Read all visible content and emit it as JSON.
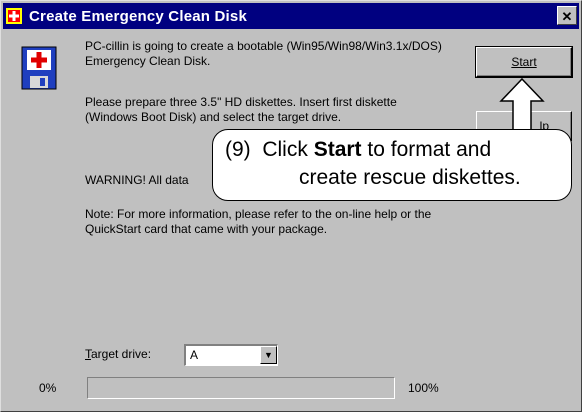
{
  "window": {
    "title": "Create Emergency Clean Disk",
    "close_glyph": "✕"
  },
  "icons": {
    "title": "pc-cillin-app-icon",
    "main": "first-aid-floppy-disk-icon"
  },
  "body": {
    "p1": "PC-cillin is going to create a bootable (Win95/Win98/Win3.1x/DOS) Emergency Clean Disk.",
    "p2": "Please prepare three 3.5\" HD diskettes.  Insert first diskette (Windows Boot Disk) and select the target drive.",
    "p3": "WARNING! All data",
    "p4": "Note: For more information, please refer to the on-line help or the QuickStart card that came with your package."
  },
  "buttons": {
    "start_label": "Start",
    "second_label_partial": "lp"
  },
  "callout": {
    "number": "(9)",
    "prefix": "Click",
    "bold": "Start",
    "suffix": "to format and",
    "line2": "create rescue diskettes."
  },
  "target_drive": {
    "label_first": "T",
    "label_rest": "arget drive:",
    "value": "A"
  },
  "progress": {
    "min_label": "0%",
    "max_label": "100%",
    "value_fraction": 0
  },
  "colors": {
    "titlebar": "#000080",
    "face": "#c0c0c0"
  }
}
